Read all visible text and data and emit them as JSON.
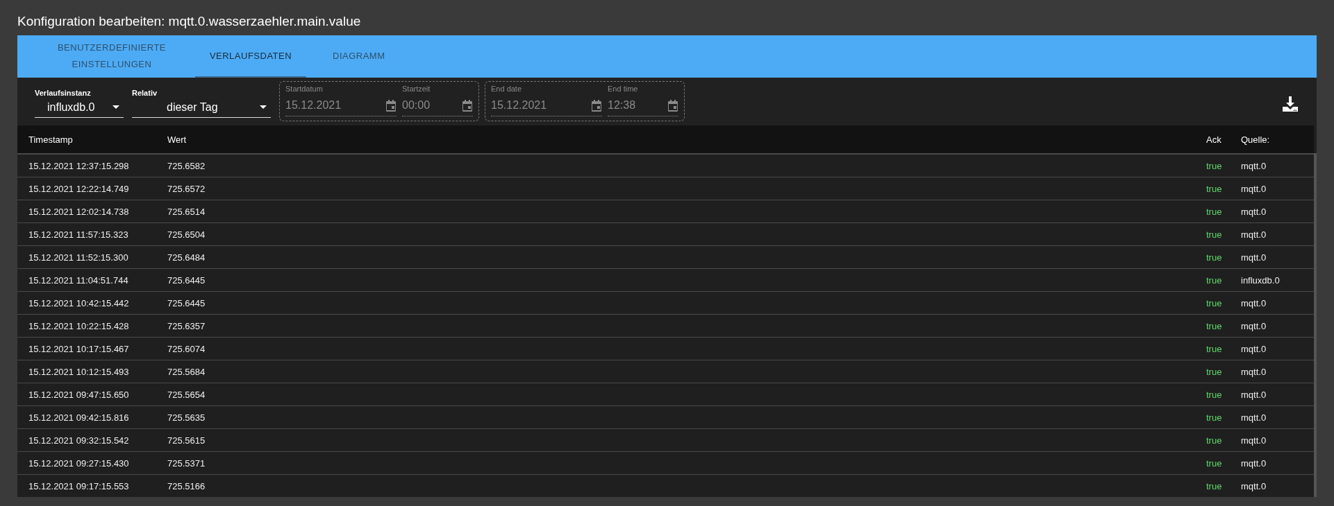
{
  "dialog": {
    "title": "Konfiguration bearbeiten: mqtt.0.wasserzaehler.main.value"
  },
  "tabs": [
    {
      "label": "BENUTZERDEFINIERTE EINSTELLUNGEN",
      "selected": false
    },
    {
      "label": "VERLAUFSDATEN",
      "selected": true
    },
    {
      "label": "DIAGRAMM",
      "selected": false
    }
  ],
  "selects": [
    {
      "label": "Verlaufsinstanz",
      "value": "influxdb.0"
    },
    {
      "label": "Relativ",
      "value": "dieser Tag"
    }
  ],
  "range_groups": [
    {
      "disabled": true,
      "date": {
        "label": "Startdatum",
        "value": "15.12.2021"
      },
      "time": {
        "label": "Startzeit",
        "value": "00:00"
      }
    },
    {
      "disabled": true,
      "date": {
        "label": "End date",
        "value": "15.12.2021"
      },
      "time": {
        "label": "End time",
        "value": "12:38"
      }
    }
  ],
  "table": {
    "columns": [
      "Timestamp",
      "Wert",
      "Ack",
      "Quelle:"
    ],
    "rows": [
      [
        "15.12.2021 12:37:15.298",
        "725.6582",
        "true",
        "mqtt.0"
      ],
      [
        "15.12.2021 12:22:14.749",
        "725.6572",
        "true",
        "mqtt.0"
      ],
      [
        "15.12.2021 12:02:14.738",
        "725.6514",
        "true",
        "mqtt.0"
      ],
      [
        "15.12.2021 11:57:15.323",
        "725.6504",
        "true",
        "mqtt.0"
      ],
      [
        "15.12.2021 11:52:15.300",
        "725.6484",
        "true",
        "mqtt.0"
      ],
      [
        "15.12.2021 11:04:51.744",
        "725.6445",
        "true",
        "influxdb.0"
      ],
      [
        "15.12.2021 10:42:15.442",
        "725.6445",
        "true",
        "mqtt.0"
      ],
      [
        "15.12.2021 10:22:15.428",
        "725.6357",
        "true",
        "mqtt.0"
      ],
      [
        "15.12.2021 10:17:15.467",
        "725.6074",
        "true",
        "mqtt.0"
      ],
      [
        "15.12.2021 10:12:15.493",
        "725.5684",
        "true",
        "mqtt.0"
      ],
      [
        "15.12.2021 09:47:15.650",
        "725.5654",
        "true",
        "mqtt.0"
      ],
      [
        "15.12.2021 09:42:15.816",
        "725.5635",
        "true",
        "mqtt.0"
      ],
      [
        "15.12.2021 09:32:15.542",
        "725.5615",
        "true",
        "mqtt.0"
      ],
      [
        "15.12.2021 09:27:15.430",
        "725.5371",
        "true",
        "mqtt.0"
      ],
      [
        "15.12.2021 09:17:15.553",
        "725.5166",
        "true",
        "mqtt.0"
      ]
    ]
  }
}
